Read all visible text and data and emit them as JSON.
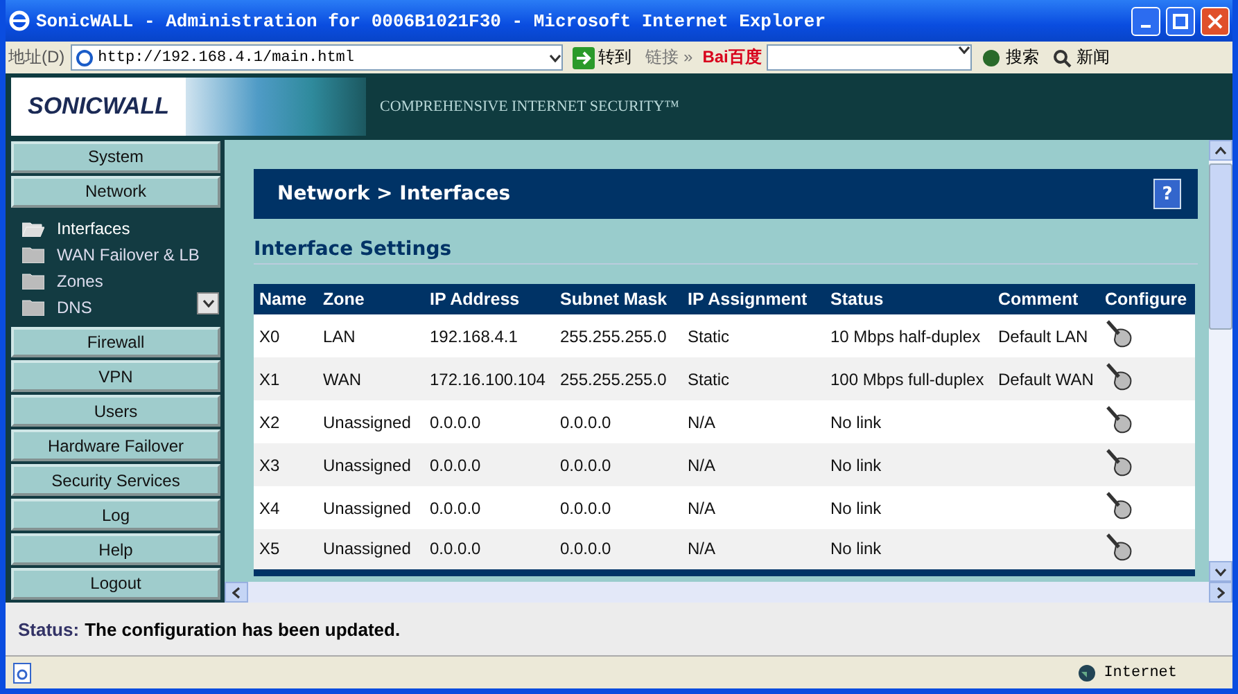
{
  "window": {
    "title": "SonicWALL - Administration for 0006B1021F30 - Microsoft Internet Explorer"
  },
  "address_bar": {
    "label": "地址(D)",
    "url": "http://192.168.4.1/main.html",
    "go_label": "转到",
    "links_label": "链接",
    "links_chevron": "»",
    "toolbar_brand": "Bai百度",
    "search_button": "搜索",
    "news_button": "新闻"
  },
  "banner": {
    "logo": "SONICWALL",
    "tagline": "COMPREHENSIVE INTERNET SECURITY™"
  },
  "sidebar": {
    "top_items": [
      {
        "label": "System"
      },
      {
        "label": "Network"
      }
    ],
    "submenu": [
      {
        "label": "Interfaces",
        "selected": true
      },
      {
        "label": "WAN Failover & LB",
        "selected": false
      },
      {
        "label": "Zones",
        "selected": false
      },
      {
        "label": "DNS",
        "selected": false
      }
    ],
    "bottom_items": [
      {
        "label": "Firewall"
      },
      {
        "label": "VPN"
      },
      {
        "label": "Users"
      },
      {
        "label": "Hardware Failover"
      },
      {
        "label": "Security Services"
      },
      {
        "label": "Log"
      },
      {
        "label": "Help"
      },
      {
        "label": "Logout"
      }
    ]
  },
  "page": {
    "breadcrumb": "Network > Interfaces",
    "help": "?",
    "section_title": "Interface Settings",
    "table": {
      "columns": [
        "Name",
        "Zone",
        "IP Address",
        "Subnet Mask",
        "IP Assignment",
        "Status",
        "Comment",
        "Configure"
      ],
      "rows": [
        {
          "cells": [
            "X0",
            "LAN",
            "192.168.4.1",
            "255.255.255.0",
            "Static",
            "10 Mbps half-duplex",
            "Default LAN"
          ]
        },
        {
          "cells": [
            "X1",
            "WAN",
            "172.16.100.104",
            "255.255.255.0",
            "Static",
            "100 Mbps full-duplex",
            "Default WAN"
          ]
        },
        {
          "cells": [
            "X2",
            "Unassigned",
            "0.0.0.0",
            "0.0.0.0",
            "N/A",
            "No link",
            ""
          ]
        },
        {
          "cells": [
            "X3",
            "Unassigned",
            "0.0.0.0",
            "0.0.0.0",
            "N/A",
            "No link",
            ""
          ]
        },
        {
          "cells": [
            "X4",
            "Unassigned",
            "0.0.0.0",
            "0.0.0.0",
            "N/A",
            "No link",
            ""
          ]
        },
        {
          "cells": [
            "X5",
            "Unassigned",
            "0.0.0.0",
            "0.0.0.0",
            "N/A",
            "No link",
            ""
          ]
        }
      ]
    }
  },
  "status": {
    "label": "Status:",
    "message": "The configuration has been updated."
  },
  "ie_status": {
    "zone": "Internet"
  }
}
